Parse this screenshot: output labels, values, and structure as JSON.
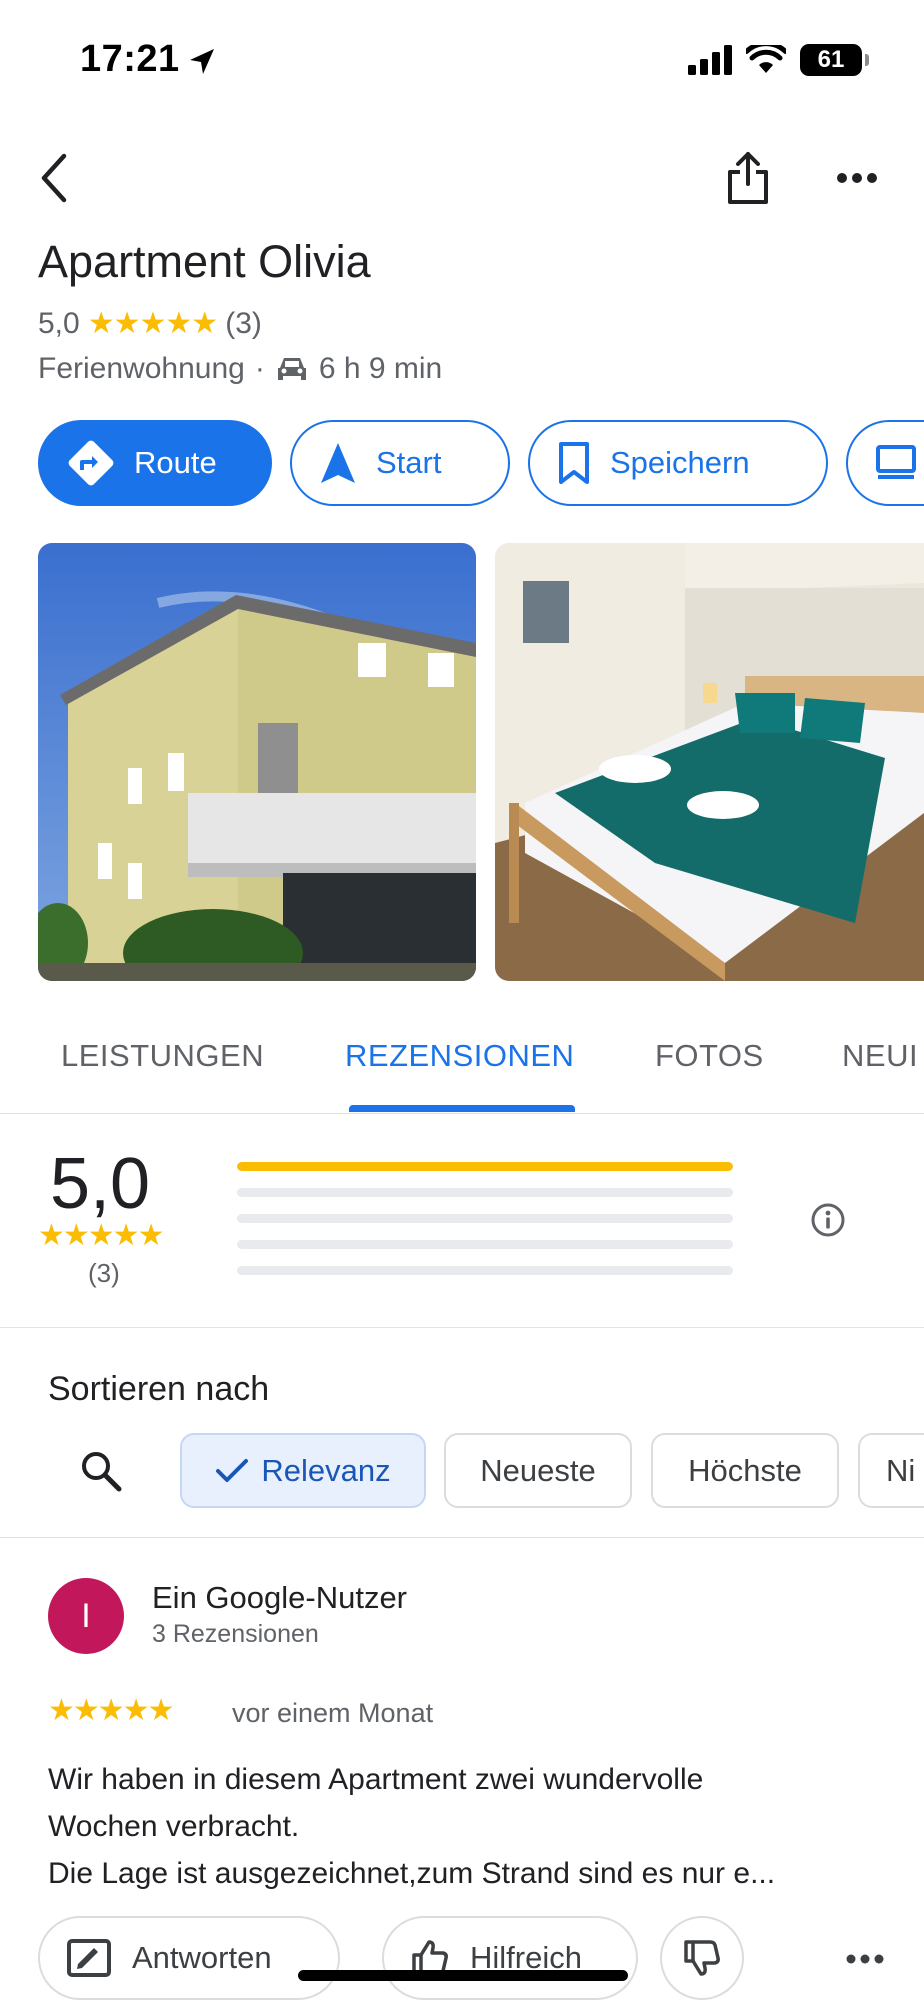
{
  "status_bar": {
    "time": "17:21",
    "battery": "61"
  },
  "place": {
    "title": "Apartment Olivia",
    "rating": "5,0",
    "stars": "★★★★★",
    "review_count": "(3)",
    "category": "Ferienwohnung",
    "separator": "·",
    "drive_time": "6 h 9 min"
  },
  "actions": [
    {
      "label": "Route",
      "icon": "directions-icon"
    },
    {
      "label": "Start",
      "icon": "navigation-arrow-icon"
    },
    {
      "label": "Speichern",
      "icon": "bookmark-icon"
    },
    {
      "label": "",
      "icon": "more-actions-icon"
    }
  ],
  "tabs": [
    {
      "label": "LEISTUNGEN"
    },
    {
      "label": "REZENSIONEN",
      "active": true
    },
    {
      "label": "FOTOS"
    },
    {
      "label": "NEUI"
    }
  ],
  "summary": {
    "rating": "5,0",
    "stars": "★★★★★",
    "count": "(3)",
    "distribution": [
      1,
      0,
      0,
      0,
      0
    ]
  },
  "sort": {
    "title": "Sortieren nach",
    "options": [
      {
        "label": "Relevanz",
        "selected": true
      },
      {
        "label": "Neueste"
      },
      {
        "label": "Höchste"
      },
      {
        "label": "Ni"
      }
    ]
  },
  "review": {
    "avatar_letter": "I",
    "author": "Ein Google-Nutzer",
    "author_sub": "3 Rezensionen",
    "stars": "★★★★★",
    "date": "vor einem Monat",
    "text_lines": [
      "Wir haben in diesem Apartment zwei wundervolle",
      "Wochen verbracht.",
      "Die Lage ist ausgezeichnet,zum Strand sind es nur e..."
    ],
    "buttons": {
      "reply": "Antworten",
      "helpful": "Hilfreich"
    }
  },
  "colors": {
    "accent": "#1a73e8",
    "star": "#fbbc04",
    "avatar": "#c2185b"
  }
}
